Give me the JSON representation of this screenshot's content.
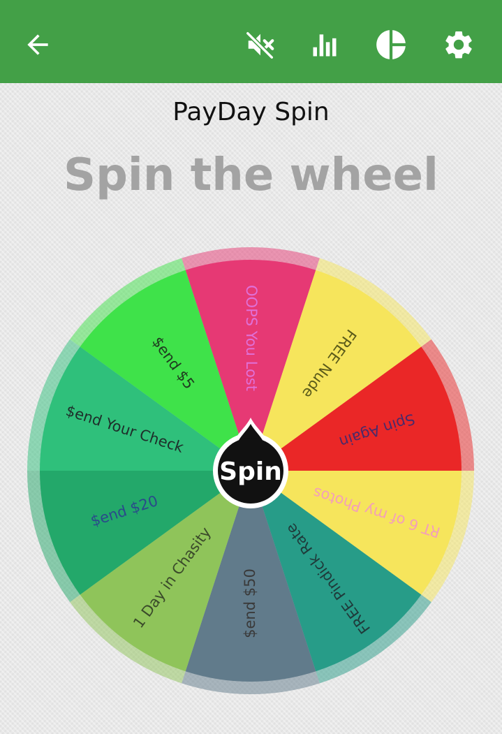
{
  "app_bar": {
    "background": "#43a047",
    "icons": {
      "back": "arrow-back-icon",
      "mute": "volume-off-icon",
      "stats": "bar-chart-icon",
      "history": "pie-chart-icon",
      "settings": "gear-icon"
    }
  },
  "wheel_title": "PayDay Spin",
  "headline": "Spin the wheel",
  "spin_button_label": "Spin",
  "segments": [
    {
      "label": "OOPS You Lost",
      "color": "#e63974",
      "text_color": "#e070d8"
    },
    {
      "label": "FREE Nude",
      "color": "#f6e55c",
      "text_color": "#5a5a1a"
    },
    {
      "label": "Spin Again",
      "color": "#ea2727",
      "text_color": "#4a2a6a"
    },
    {
      "label": "RT 6 of my Photos",
      "color": "#f6e55c",
      "text_color": "#f3a0b8"
    },
    {
      "label": "FREE Pindick Rate",
      "color": "#279c88",
      "text_color": "#1f3a3a"
    },
    {
      "label": "$end $50",
      "color": "#617b8b",
      "text_color": "#3a3a3a"
    },
    {
      "label": "1 Day in Chasity",
      "color": "#8fc45a",
      "text_color": "#3a4a2a"
    },
    {
      "label": "$end $20",
      "color": "#23a86a",
      "text_color": "#2a4a8a"
    },
    {
      "label": "$end Your Check",
      "color": "#2fc07b",
      "text_color": "#1e2e2a"
    },
    {
      "label": "$end $5",
      "color": "#3fe24a",
      "text_color": "#1f3a1f"
    }
  ]
}
